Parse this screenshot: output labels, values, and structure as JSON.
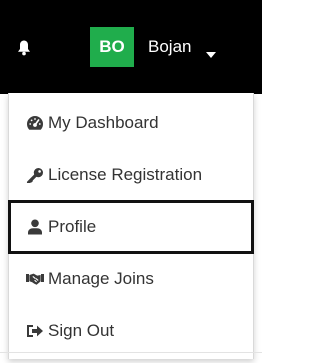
{
  "header": {
    "avatar_initials": "BO",
    "user_name": "Bojan",
    "bell_icon": "bell-icon",
    "caret_icon": "caret-down-icon",
    "colors": {
      "bar": "#000000",
      "avatar": "#20ad4c"
    }
  },
  "menu": {
    "items": [
      {
        "label": "My Dashboard",
        "icon": "dashboard-icon"
      },
      {
        "label": "License Registration",
        "icon": "key-icon"
      },
      {
        "label": "Profile",
        "icon": "user-icon",
        "selected": true
      },
      {
        "label": "Manage Joins",
        "icon": "handshake-icon"
      },
      {
        "label": "Sign Out",
        "icon": "sign-out-icon"
      }
    ]
  }
}
